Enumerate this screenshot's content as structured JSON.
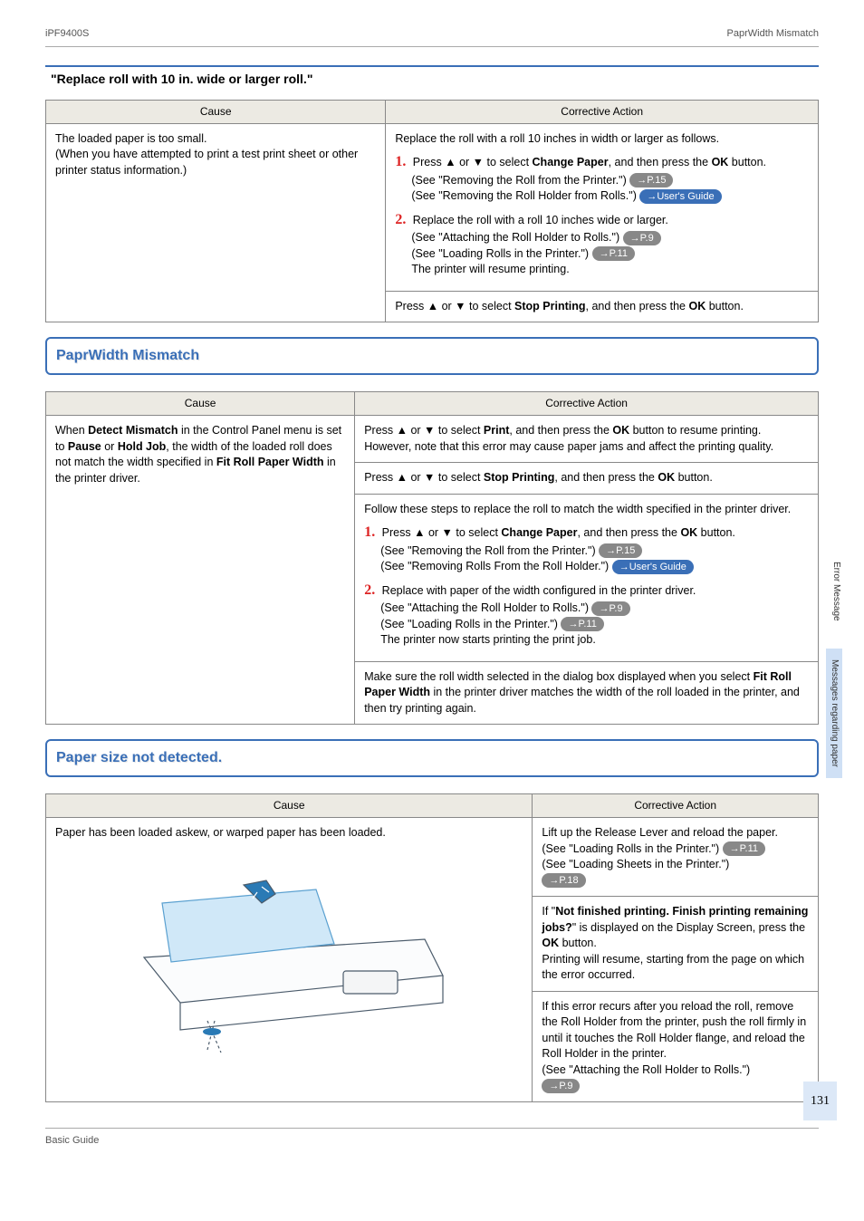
{
  "header": {
    "left": "iPF9400S",
    "right": "PaprWidth Mismatch"
  },
  "section1": {
    "title": "\"Replace roll with 10 in. wide or larger roll.\"",
    "col_cause": "Cause",
    "col_action": "Corrective Action",
    "cause": "The loaded paper is too small.\n(When you have attempted to print a test print sheet or other printer status information.)",
    "action_intro": "Replace the roll with a roll 10 inches in width or larger as follows.",
    "step1": "Press ▲ or ▼ to select Change Paper, and then press the OK button.",
    "step1_see1": " (See \"Removing the Roll from the Printer.\") ",
    "step1_pill1": "→P.15",
    "step1_see2": " (See \"Removing the Roll Holder from Rolls.\") ",
    "step1_pill2": "→User's Guide",
    "step2": "Replace the roll with a roll 10 inches wide or larger.",
    "step2_see1": " (See \"Attaching the Roll Holder to Rolls.\") ",
    "step2_pill1": "→P.9",
    "step2_see2": " (See \"Loading Rolls in the Printer.\") ",
    "step2_pill2": "→P.11",
    "step2_tail": " The printer will resume printing.",
    "row2": "Press ▲ or ▼ to select Stop Printing, and then press the OK button."
  },
  "section2": {
    "title": "PaprWidth Mismatch",
    "col_cause": "Cause",
    "col_action": "Corrective Action",
    "cause": "When Detect Mismatch in the Control Panel menu is set to Pause or Hold Job, the width of the loaded roll does not match the width specified in Fit Roll Paper Width in the printer driver.",
    "r1": "Press ▲ or ▼ to select Print, and then press the OK button to resume printing. However, note that this error may cause paper jams and affect the printing quality.",
    "r2": "Press ▲ or ▼ to select Stop Printing, and then press the OK button.",
    "r3_intro": "Follow these steps to replace the roll to match the width specified in the printer driver.",
    "r3_step1": "Press ▲ or ▼ to select Change Paper, and then press the OK button.",
    "r3_s1_see1": " (See \"Removing the Roll from the Printer.\") ",
    "r3_s1_p1": "→P.15",
    "r3_s1_see2": " (See \"Removing Rolls From the Roll Holder.\") ",
    "r3_s1_p2": "→User's Guide",
    "r3_step2": "Replace with paper of the width configured in the printer driver.",
    "r3_s2_see1": " (See \"Attaching the Roll Holder to Rolls.\") ",
    "r3_s2_p1": "→P.9",
    "r3_s2_see2": " (See \"Loading Rolls in the Printer.\") ",
    "r3_s2_p2": "→P.11",
    "r3_s2_tail": " The printer now starts printing the print job.",
    "r4": "Make sure the roll width selected in the dialog box displayed when you select Fit Roll Paper Width in the printer driver matches the width of the roll loaded in the printer, and then try printing again."
  },
  "section3": {
    "title": "Paper size not detected.",
    "col_cause": "Cause",
    "col_action": "Corrective Action",
    "cause": "Paper has been loaded askew, or warped paper has been loaded.",
    "r1a": "Lift up the Release Lever and reload the paper.",
    "r1_see1": " (See \"Loading Rolls in the Printer.\") ",
    "r1_p1": "→P.11",
    "r1_see2": " (See \"Loading Sheets in the Printer.\")",
    "r1_p2": "→P.18",
    "r2_a": "If \"Not finished printing. Finish printing remaining jobs?\" is displayed on the Display Screen, press the OK button.",
    "r2_b": "Printing will resume, starting from the page on which the error occurred.",
    "r3_a": "If this error recurs after you reload the roll, remove the Roll Holder from the printer, push the roll firmly in until it touches the Roll Holder flange, and reload the Roll Holder in the printer.",
    "r3_see": " (See \"Attaching the Roll Holder to Rolls.\")",
    "r3_p": "→P.9"
  },
  "side": {
    "seg1": "Error Message",
    "seg2": "Messages regarding paper"
  },
  "page_number": "131",
  "footer": "Basic Guide"
}
